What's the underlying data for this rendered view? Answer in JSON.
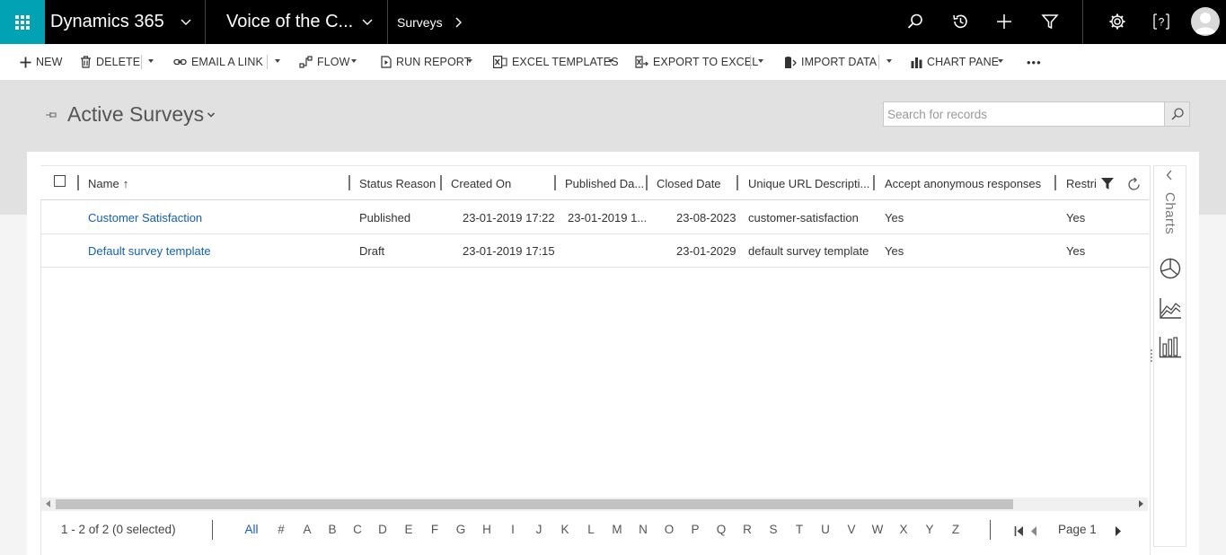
{
  "nav": {
    "brand": "Dynamics 365",
    "app_name": "Voice of the C...",
    "breadcrumb": "Surveys",
    "icons": [
      "app-launcher-icon",
      "search-icon",
      "recent-icon",
      "add-icon",
      "filter-icon",
      "settings-icon",
      "help-icon",
      "user-avatar-icon"
    ]
  },
  "commands": {
    "new": "NEW",
    "delete": "DELETE",
    "email_link": "EMAIL A LINK",
    "flow": "FLOW",
    "run_report": "RUN REPORT",
    "excel_templates": "EXCEL TEMPLATES",
    "export_excel": "EXPORT TO EXCEL",
    "import_data": "IMPORT DATA",
    "chart_pane": "CHART PANE",
    "more": "•••"
  },
  "view": {
    "title": "Active Surveys",
    "search_placeholder": "Search for records"
  },
  "grid": {
    "columns": {
      "name": "Name",
      "sort_indicator": "↑",
      "status_reason": "Status Reason",
      "created_on": "Created On",
      "published_date": "Published Da...",
      "closed_date": "Closed Date",
      "unique_url": "Unique URL Descripti...",
      "accept_anonymous": "Accept anonymous responses",
      "restrict": "Restri"
    },
    "rows": [
      {
        "name": "Customer Satisfaction",
        "status_reason": "Published",
        "created_on": "23-01-2019 17:22",
        "published_date": "23-01-2019 1...",
        "closed_date": "23-08-2023",
        "unique_url": "customer-satisfaction",
        "accept_anonymous": "Yes",
        "restrict": "Yes"
      },
      {
        "name": "Default survey template",
        "status_reason": "Draft",
        "created_on": "23-01-2019 17:15",
        "published_date": "",
        "closed_date": "23-01-2029",
        "unique_url": "default survey template",
        "accept_anonymous": "Yes",
        "restrict": "Yes"
      }
    ]
  },
  "footer": {
    "count": "1 - 2 of 2 (0 selected)",
    "letters": [
      "All",
      "#",
      "A",
      "B",
      "C",
      "D",
      "E",
      "F",
      "G",
      "H",
      "I",
      "J",
      "K",
      "L",
      "M",
      "N",
      "O",
      "P",
      "Q",
      "R",
      "S",
      "T",
      "U",
      "V",
      "W",
      "X",
      "Y",
      "Z"
    ],
    "active_letter": "All",
    "page": "Page 1"
  },
  "charts_pane": {
    "label": "Charts"
  },
  "colors": {
    "nav_bg": "#000000",
    "waffle_bg": "#00a2b4",
    "link": "#1160b7",
    "band": "#e1e1e1"
  }
}
